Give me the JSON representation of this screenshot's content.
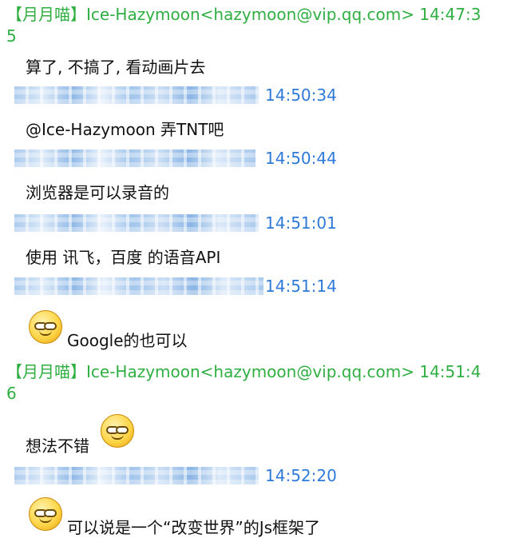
{
  "chat": {
    "header1": "【月月喵】Ice-Hazymoon<hazymoon@vip.qq.com> 14:47:3",
    "header1_wrap": "5",
    "m1": "算了, 不搞了, 看动画片去",
    "t1": "14:50:34",
    "m2": "@Ice-Hazymoon 弄TNT吧",
    "t2": "14:50:44",
    "m3": "浏览器是可以录音的",
    "t3": "14:51:01",
    "m4": "使用 讯飞，百度 的语音API",
    "t4": "14:51:14",
    "m5": "Google的也可以",
    "header2": "【月月喵】Ice-Hazymoon<hazymoon@vip.qq.com> 14:51:4",
    "header2_wrap": "6",
    "m6": "想法不错",
    "t6": "14:52:20",
    "m7": "可以说是一个“改变世界”的Js框架了"
  },
  "icons": {
    "emoji": "grin-emoji-icon"
  },
  "colors": {
    "header": "#2fae42",
    "timestamp": "#2f79d8",
    "text": "#111111"
  }
}
